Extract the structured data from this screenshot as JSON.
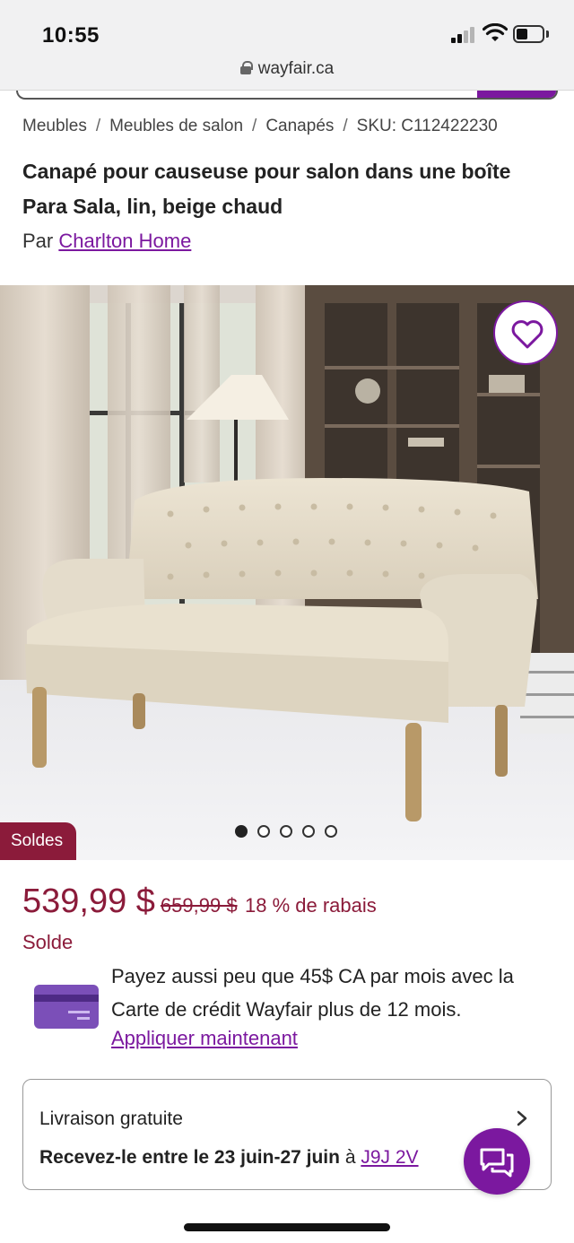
{
  "status_bar": {
    "time": "10:55"
  },
  "browser": {
    "url": "wayfair.ca"
  },
  "breadcrumb": {
    "items": [
      "Meubles",
      "Meubles de salon",
      "Canapés",
      "SKU: C112422230"
    ],
    "separator": "/"
  },
  "product": {
    "title": "Canapé pour causeuse pour salon dans une boîte Para Sala, lin, beige chaud",
    "by_prefix": "Par",
    "brand": "Charlton Home",
    "sale_badge": "Soldes",
    "carousel": {
      "total": 5,
      "active_index": 0
    }
  },
  "pricing": {
    "price": "539,99 $",
    "old_price": "659,99 $",
    "discount": "18 % de rabais",
    "sale_label": "Solde"
  },
  "credit": {
    "text": "Payez aussi peu que 45$ CA par mois avec la Carte de crédit Wayfair plus de 12 mois.",
    "link": "Appliquer maintenant"
  },
  "delivery": {
    "title": "Livraison gratuite",
    "dates": "Recevez-le entre le 23 juin-27 juin",
    "connector": "à",
    "postal_code": "J9J 2V"
  },
  "colors": {
    "brand_purple": "#7b189f",
    "sale_red": "#8b1b3a",
    "card_purple": "#7b4fb8"
  },
  "icons": {
    "favorite": "heart-icon",
    "chat": "chat-icon",
    "lock": "lock-icon",
    "chevron": "chevron-right-icon",
    "credit_card": "credit-card-icon"
  }
}
